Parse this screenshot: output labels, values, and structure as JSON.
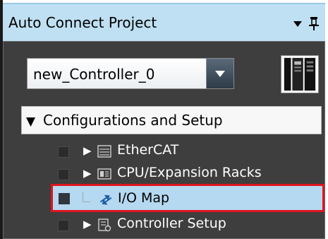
{
  "panel": {
    "title": "Auto Connect Project",
    "dropdown_icon": "chevron-down-icon",
    "pin_icon": "pin-icon"
  },
  "controller_selector": {
    "value": "new_Controller_0",
    "dropdown_icon": "chevron-down-icon"
  },
  "controller_thumbnail_icon": "controller-hardware-icon",
  "tree": {
    "root": {
      "expander": "▼",
      "label": "Configurations and Setup"
    },
    "items": [
      {
        "expander": "▶",
        "icon": "ethercat-icon",
        "label": "EtherCAT",
        "selected": false
      },
      {
        "expander": "▶",
        "icon": "cpu-racks-icon",
        "label": "CPU/Expansion Racks",
        "selected": false
      },
      {
        "expander": "",
        "icon": "io-map-icon",
        "label": "I/O Map",
        "selected": true
      },
      {
        "expander": "▶",
        "icon": "controller-setup-icon",
        "label": "Controller Setup",
        "selected": false
      }
    ]
  },
  "colors": {
    "title_bar": "#bfe0f2",
    "content_bg": "#3e3e3e",
    "selected_bg": "#b5d9f0",
    "highlight_border": "#e0141e"
  }
}
